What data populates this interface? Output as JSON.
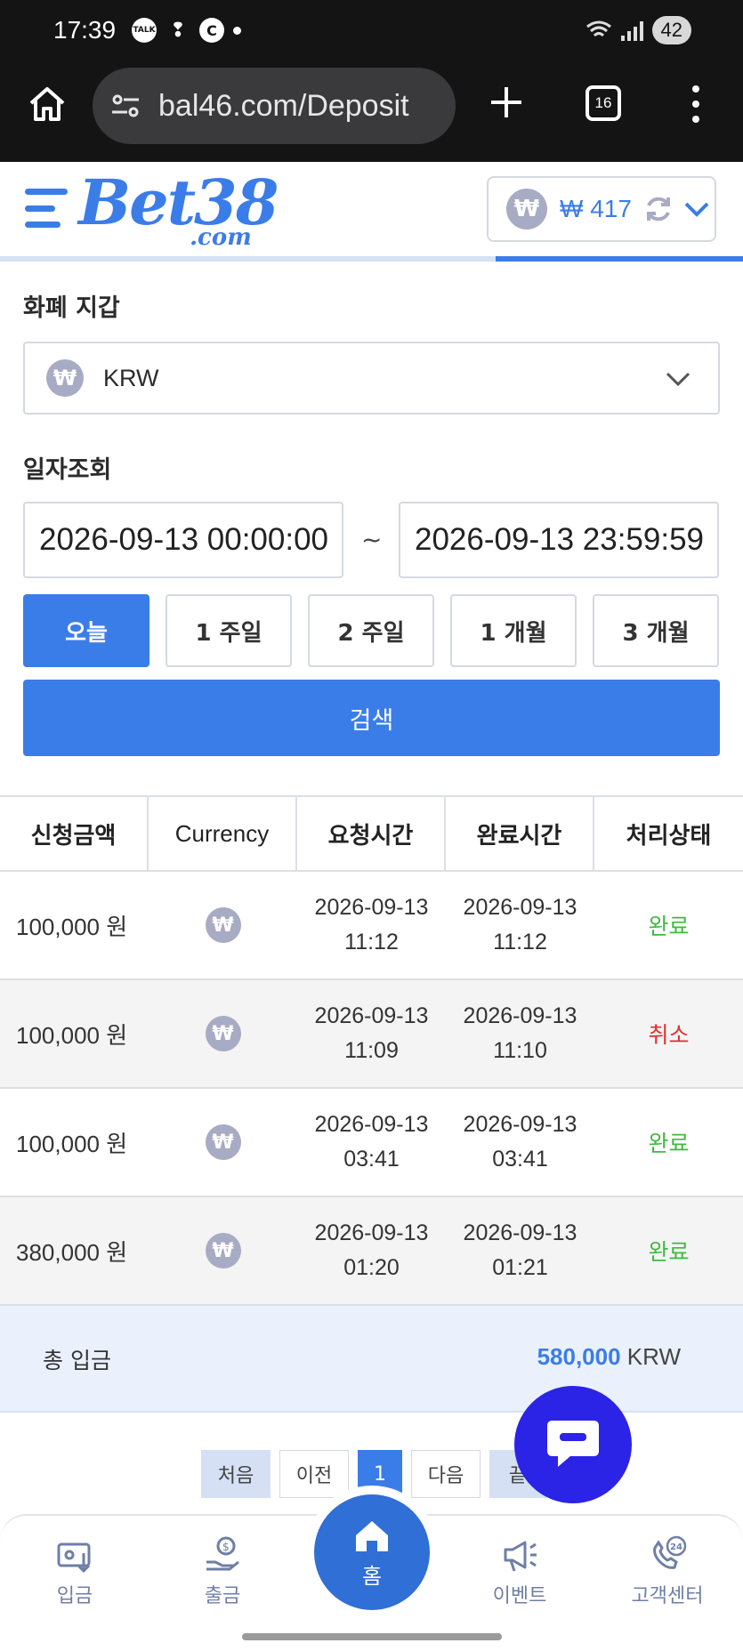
{
  "status_bar": {
    "time": "17:39",
    "icons": [
      "talk-icon",
      "footprint-icon",
      "c-icon",
      "dot-icon"
    ],
    "talk_label": "TALK",
    "c_label": "C",
    "battery": "42"
  },
  "browser": {
    "url": "bal46.com/Deposit",
    "tab_count": "16"
  },
  "header": {
    "logo_main": "Bet38",
    "logo_sub": ".com",
    "wallet_symbol": "₩",
    "wallet_amount": "₩ 417",
    "accent_color": "#3b7de8"
  },
  "wallet_section": {
    "title": "화폐 지갑",
    "selected_currency": "KRW",
    "currency_symbol": "₩"
  },
  "date_section": {
    "title": "일자조회",
    "start": "2026-09-13 00:00:00",
    "end": "2026-09-13 23:59:59",
    "separator": "~"
  },
  "period_buttons": [
    {
      "label": "오늘",
      "active": true
    },
    {
      "label": "1 주일",
      "active": false
    },
    {
      "label": "2 주일",
      "active": false
    },
    {
      "label": "1 개월",
      "active": false
    },
    {
      "label": "3 개월",
      "active": false
    }
  ],
  "search_label": "검색",
  "table": {
    "headers": [
      "신청금액",
      "Currency",
      "요청시간",
      "완료시간",
      "처리상태"
    ],
    "rows": [
      {
        "amount": "100,000 원",
        "currency": "₩",
        "req_date": "2026-09-13",
        "req_time": "11:12",
        "done_date": "2026-09-13",
        "done_time": "11:12",
        "status": "완료",
        "status_color": "#3fba3f"
      },
      {
        "amount": "100,000 원",
        "currency": "₩",
        "req_date": "2026-09-13",
        "req_time": "11:09",
        "done_date": "2026-09-13",
        "done_time": "11:10",
        "status": "취소",
        "status_color": "#e0322f"
      },
      {
        "amount": "100,000 원",
        "currency": "₩",
        "req_date": "2026-09-13",
        "req_time": "03:41",
        "done_date": "2026-09-13",
        "done_time": "03:41",
        "status": "완료",
        "status_color": "#3fba3f"
      },
      {
        "amount": "380,000 원",
        "currency": "₩",
        "req_date": "2026-09-13",
        "req_time": "01:20",
        "done_date": "2026-09-13",
        "done_time": "01:21",
        "status": "완료",
        "status_color": "#3fba3f"
      }
    ]
  },
  "total": {
    "label": "총 입금",
    "amount": "580,000",
    "unit": "KRW"
  },
  "pagination": {
    "first": "처음",
    "prev": "이전",
    "current": "1",
    "next": "다음",
    "last": "끝"
  },
  "bottom_nav": {
    "deposit": "입금",
    "withdraw": "출금",
    "home": "홈",
    "event": "이벤트",
    "support": "고객센터",
    "support_badge": "24"
  }
}
